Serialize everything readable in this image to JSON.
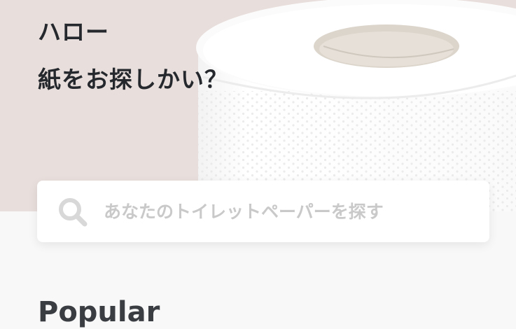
{
  "header": {
    "greeting": "ハロー",
    "subtitle": "紙をお探しかい？"
  },
  "hero": {
    "image": "toilet-paper-roll",
    "background_color": "#e8dedb"
  },
  "search": {
    "icon": "search-icon",
    "placeholder": "あなたのトイレットペーパーを探す",
    "value": ""
  },
  "sections": {
    "popular_title": "Popular"
  },
  "colors": {
    "text_dark": "#25282d",
    "placeholder": "#c9c9c9",
    "page_background": "#f8f8f8"
  }
}
